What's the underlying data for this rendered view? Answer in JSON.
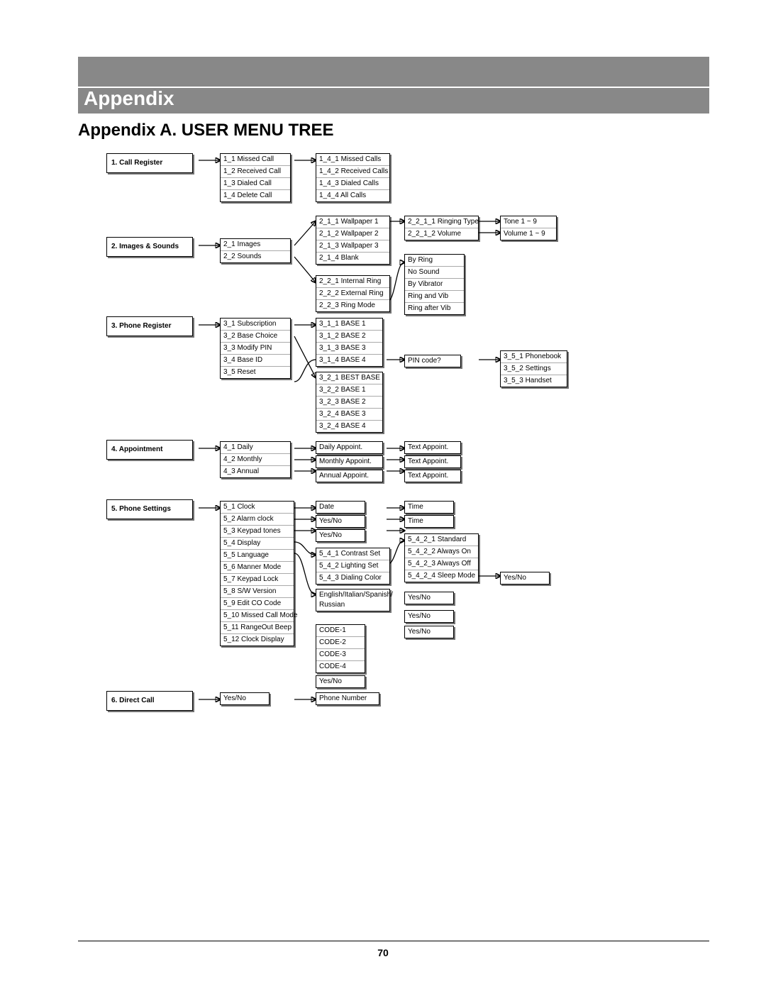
{
  "header": {
    "appendix": "Appendix",
    "section": "Appendix A. USER MENU TREE",
    "page_number": "70"
  },
  "col1": {
    "call_register": "1. Call Register",
    "images_sounds": "2. Images & Sounds",
    "phone_register": "3. Phone Register",
    "appointment": "4. Appointment",
    "phone_settings": "5. Phone Settings",
    "direct_call": "6. Direct Call"
  },
  "call_register_items": [
    "1_1 Missed Call",
    "1_2 Received Call",
    "1_3 Dialed Call",
    "1_4 Delete Call"
  ],
  "delete_call_items": [
    "1_4_1 Missed Calls",
    "1_4_2 Received Calls",
    "1_4_3 Dialed Calls",
    "1_4_4 All Calls"
  ],
  "images_sounds_items": [
    "2_1 Images",
    "2_2 Sounds"
  ],
  "images_sub": [
    "2_1_1 Wallpaper 1",
    "2_1_2 Wallpaper 2",
    "2_1_3 Wallpaper 3",
    "2_1_4 Blank"
  ],
  "sounds_sub": [
    "2_2_1 Internal Ring",
    "2_2_2 External Ring",
    "2_2_3 Ring Mode"
  ],
  "ring_type_vol": [
    "2_2_1_1 Ringing Type",
    "2_2_1_2 Volume"
  ],
  "tone_vol": [
    "Tone 1 ~ 9",
    "Volume 1 ~ 9"
  ],
  "ring_mode_opts": [
    "By Ring",
    "No Sound",
    "By Vibrator",
    "Ring and Vib",
    "Ring after Vib"
  ],
  "phone_register_items": [
    "3_1 Subscription",
    "3_2 Base Choice",
    "3_3 Modify PIN",
    "3_4 Base ID",
    "3_5 Reset"
  ],
  "subscription_bases": [
    "3_1_1 BASE 1",
    "3_1_2 BASE 2",
    "3_1_3 BASE 3",
    "3_1_4 BASE 4"
  ],
  "base_choice": [
    "3_2_1 BEST BASE",
    "3_2_2 BASE 1",
    "3_2_3 BASE 2",
    "3_2_4 BASE 3",
    "3_2_4 BASE 4"
  ],
  "pin_code": "PIN code?",
  "reset_items": [
    "3_5_1 Phonebook",
    "3_5_2 Settings",
    "3_5_3 Handset"
  ],
  "appointment_items": [
    "4_1 Daily",
    "4_2 Monthly",
    "4_3 Annual"
  ],
  "appoint_sub": [
    "Daily Appoint.",
    "Monthly Appoint.",
    "Annual Appoint."
  ],
  "text_appoint": "Text Appoint.",
  "phone_settings_items": [
    "5_1 Clock",
    "5_2 Alarm clock",
    "5_3 Keypad tones",
    "5_4 Display",
    "5_5 Language",
    "5_6 Manner Mode",
    "5_7 Keypad Lock",
    "5_8 S/W Version",
    "5_9 Edit CO Code",
    "5_10 Missed Call Mode",
    "5_11 RangeOut Beep",
    "5_12 Clock Display"
  ],
  "clock_date": "Date",
  "clock_time": "Time",
  "yesno": "Yes/No",
  "display_sub": [
    "5_4_1 Contrast Set",
    "5_4_2 Lighting Set",
    "5_4_3 Dialing Color"
  ],
  "lighting_sub": [
    "5_4_2_1 Standard",
    "5_4_2_2 Always On",
    "5_4_2_3 Always Off",
    "5_4_2_4 Sleep Mode"
  ],
  "language_opts": "English/Italian/Spanish/\nRussian",
  "co_codes": [
    "CODE-1",
    "CODE-2",
    "CODE-3",
    "CODE-4"
  ],
  "direct_call_sub": "Yes/No",
  "phone_number": "Phone Number"
}
